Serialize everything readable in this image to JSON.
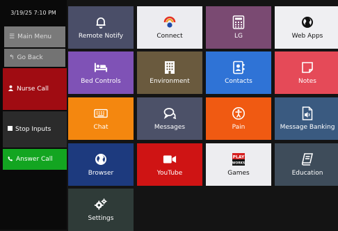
{
  "sidebar": {
    "timestamp": "3/19/25 7:10 PM",
    "main_menu": "Main Menu",
    "go_back": "Go Back",
    "nurse_call": "Nurse Call",
    "stop_inputs": "Stop Inputs",
    "answer_call": "Answer Call"
  },
  "tiles": [
    {
      "label": "Remote Notify",
      "icon": "bell-icon",
      "color": "#4a4e68"
    },
    {
      "label": "Connect",
      "icon": "connect-logo-icon",
      "color": "#ececf0"
    },
    {
      "label": "LG",
      "icon": "remote-control-icon",
      "color": "#7a4a72"
    },
    {
      "label": "Web Apps",
      "icon": "globe-icon",
      "color": "#efeff2"
    },
    {
      "label": "Bed Controls",
      "icon": "bed-icon",
      "color": "#7f52b6"
    },
    {
      "label": "Environment",
      "icon": "building-icon",
      "color": "#6a5a3e"
    },
    {
      "label": "Contacts",
      "icon": "contact-book-icon",
      "color": "#2f73d6"
    },
    {
      "label": "Notes",
      "icon": "note-icon",
      "color": "#e54a58"
    },
    {
      "label": "Chat",
      "icon": "keyboard-icon",
      "color": "#f4870f"
    },
    {
      "label": "Messages",
      "icon": "chat-bubbles-icon",
      "color": "#4c5168"
    },
    {
      "label": "Pain",
      "icon": "accessibility-icon",
      "color": "#f05a12"
    },
    {
      "label": "Message Banking",
      "icon": "audio-file-icon",
      "color": "#3a5a80"
    },
    {
      "label": "Browser",
      "icon": "globe-icon",
      "color": "#1d3a7e"
    },
    {
      "label": "YouTube",
      "icon": "video-camera-icon",
      "color": "#cf1414"
    },
    {
      "label": "Games",
      "icon": "playworks-logo-icon",
      "color": "#ededf0"
    },
    {
      "label": "Education",
      "icon": "book-icon",
      "color": "#3e4c5a"
    },
    {
      "label": "Settings",
      "icon": "gears-icon",
      "color": "#2f3b38"
    }
  ],
  "playworks_logo": "PLAY WORKS"
}
